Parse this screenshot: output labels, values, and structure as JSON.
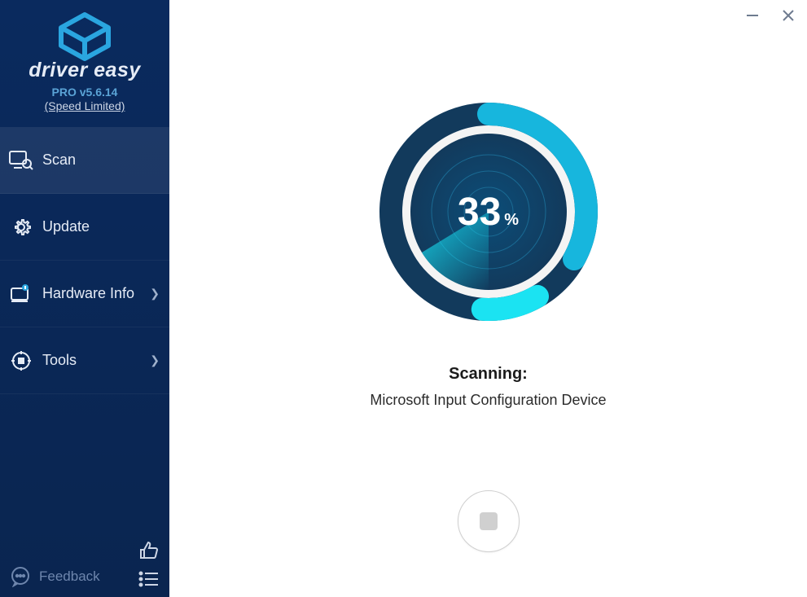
{
  "brand": {
    "name": "driver easy",
    "version_line": "PRO v5.6.14",
    "speed_limited": "(Speed Limited)"
  },
  "nav": {
    "scan": "Scan",
    "update": "Update",
    "hardware_info": "Hardware Info",
    "tools": "Tools"
  },
  "footer": {
    "feedback": "Feedback"
  },
  "scan": {
    "progress_value": "33",
    "progress_unit": "%",
    "status_label": "Scanning:",
    "current_device": "Microsoft Input Configuration Device"
  },
  "colors": {
    "ring_dark": "#0f3b66",
    "ring_bright": "#1aa3c8",
    "ring_cyan": "#19d3e6",
    "sidebar": "#0a2a5e"
  }
}
